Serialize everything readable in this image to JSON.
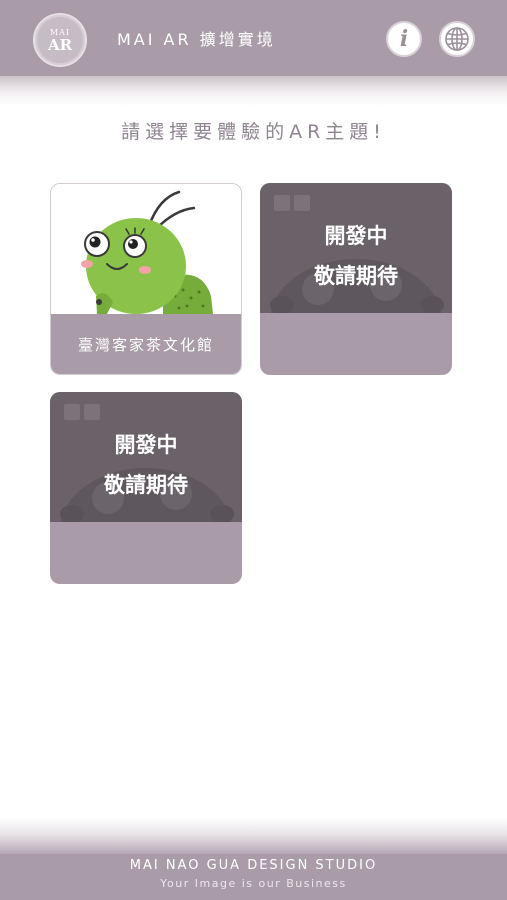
{
  "header": {
    "logo": {
      "top": "MAI",
      "bottom": "AR"
    },
    "title": "MAI AR 擴增實境",
    "info_icon": "info-icon",
    "globe_icon": "globe-icon",
    "background_color": "#a99ca8"
  },
  "prompt": "請選擇要體驗的AR主題!",
  "cards": [
    {
      "label": "臺灣客家茶文化館",
      "art": "green-grasshopper-mascot",
      "status": "active"
    },
    {
      "line1": "開發中",
      "line2": "敬請期待",
      "status": "in-development"
    },
    {
      "line1": "開發中",
      "line2": "敬請期待",
      "status": "in-development"
    }
  ],
  "footer": {
    "studio": "MAI NAO GUA DESIGN STUDIO",
    "tagline": "Your Image is our Business"
  },
  "colors": {
    "brand": "#a99ca8",
    "card_dark": "#6a6169",
    "prompt_text": "#8f8491"
  }
}
